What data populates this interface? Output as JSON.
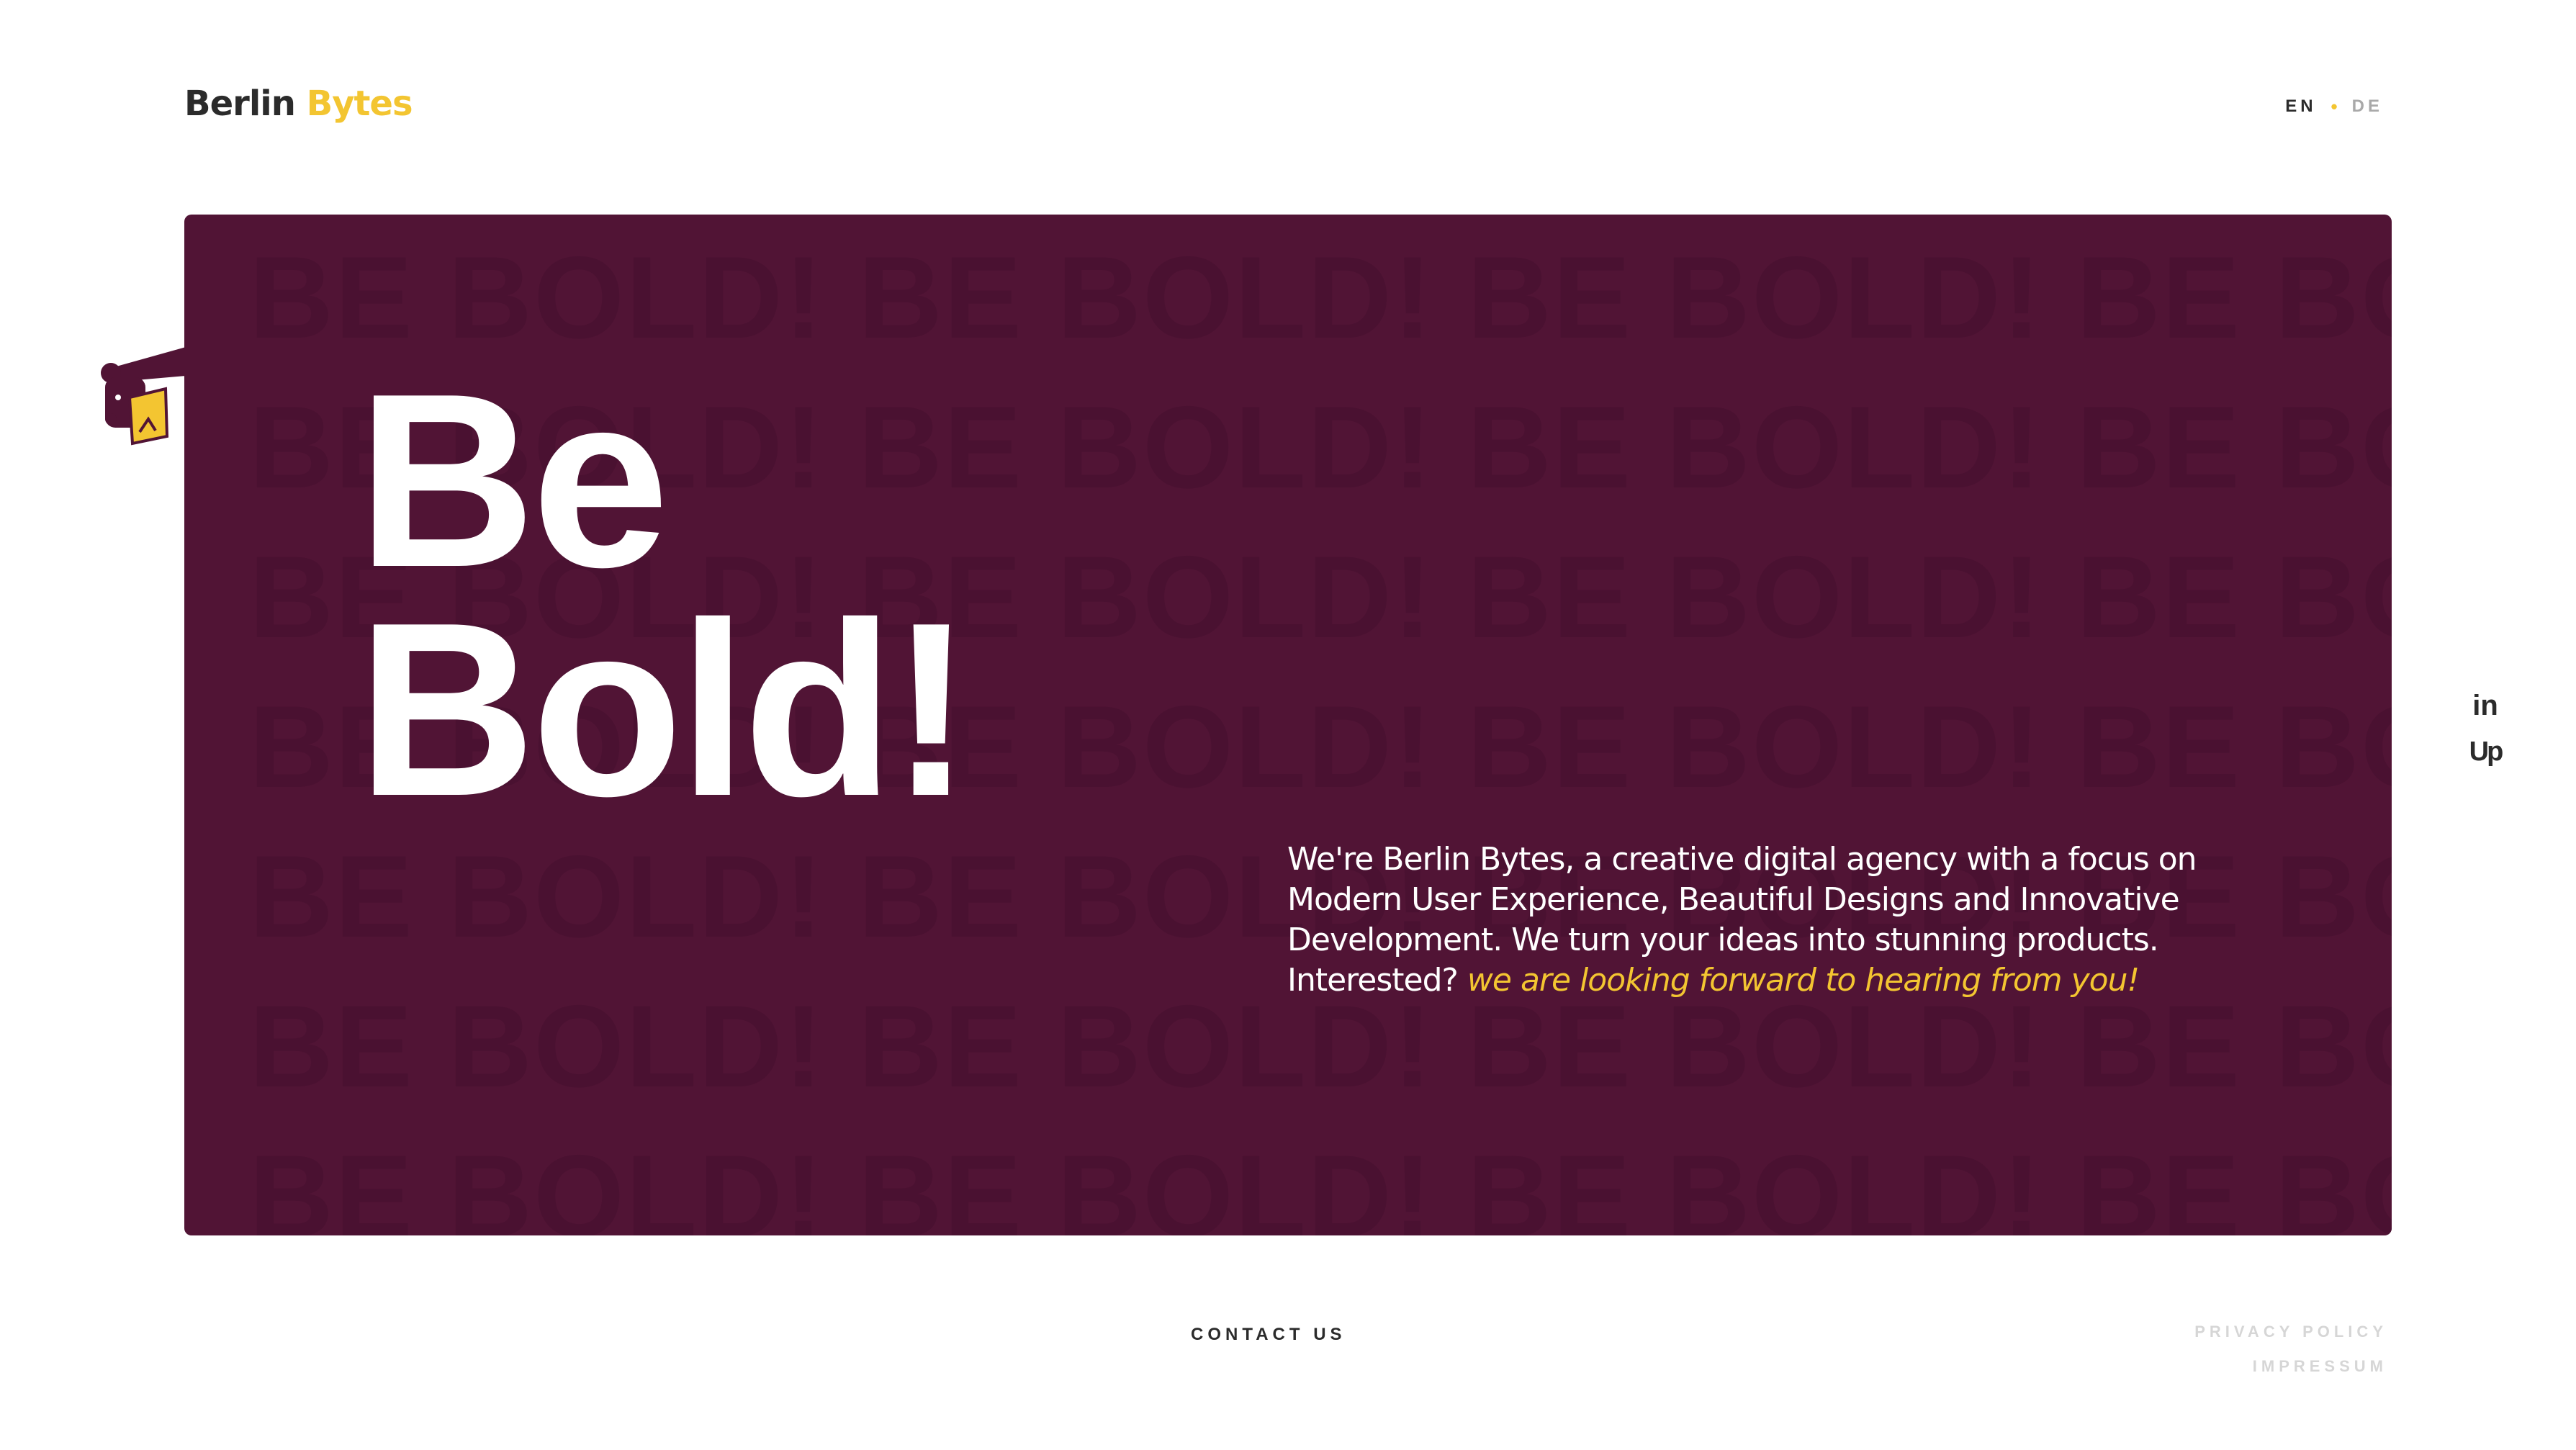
{
  "header": {
    "logo_word1": "Berlin",
    "logo_word2": "Bytes",
    "lang_en": "EN",
    "lang_separator": "•",
    "lang_de": "DE"
  },
  "hero": {
    "background_text": "BE BOLD! BE BOLD! BE BOLD! BE BOLD! BE BOLD!",
    "headline_line1": "Be",
    "headline_line2": "Bold!",
    "intro_text": "We're Berlin Bytes, a creative digital agency with a focus on Modern User Experience, Beautiful Designs and Innovative Development. We turn your ideas into stunning products. Interested?",
    "intro_highlight": "we are looking forward to hearing from you!"
  },
  "social": {
    "linkedin_label": "in",
    "upwork_label": "Up"
  },
  "footer": {
    "contact_label": "CONTACT US",
    "privacy_label": "PRIVACY POLICY",
    "impressum_label": "IMPRESSUM"
  },
  "colors": {
    "brand_yellow": "#f3c531",
    "card_background": "#511435",
    "text_dark": "#2b2b2b"
  }
}
